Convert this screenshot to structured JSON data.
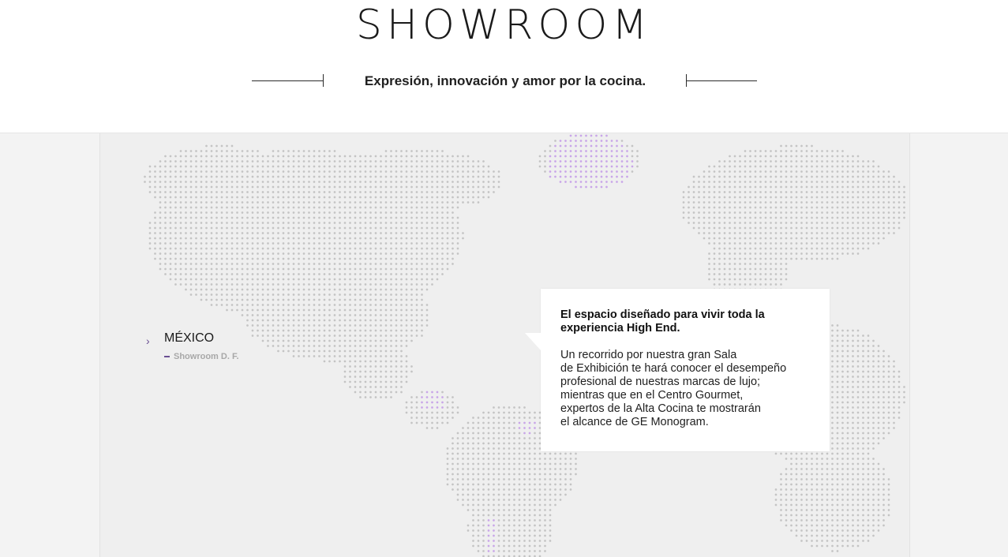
{
  "header": {
    "title": "SHOWROOM",
    "tagline": "Expresión, innovación y amor por la cocina."
  },
  "locations": {
    "country": "MÉXICO",
    "item": "Showroom D. F."
  },
  "popup": {
    "heading": "El espacio diseñado para vivir toda la experiencia High End.",
    "body_lines": [
      "Un recorrido por nuestra gran Sala",
      "de Exhibición te hará conocer el desempeño",
      "profesional de nuestras marcas de lujo;",
      "mientras que en el Centro Gourmet,",
      "expertos de la Alta Cocina te mostrarán",
      "el alcance de GE Monogram."
    ]
  },
  "colors": {
    "accent": "#6a4f93",
    "highlight_dots": "#c9a6e8",
    "map_dots": "#c4c4c4",
    "background": "#efefef"
  },
  "icons": {
    "chevron": "chevron-right-icon"
  }
}
